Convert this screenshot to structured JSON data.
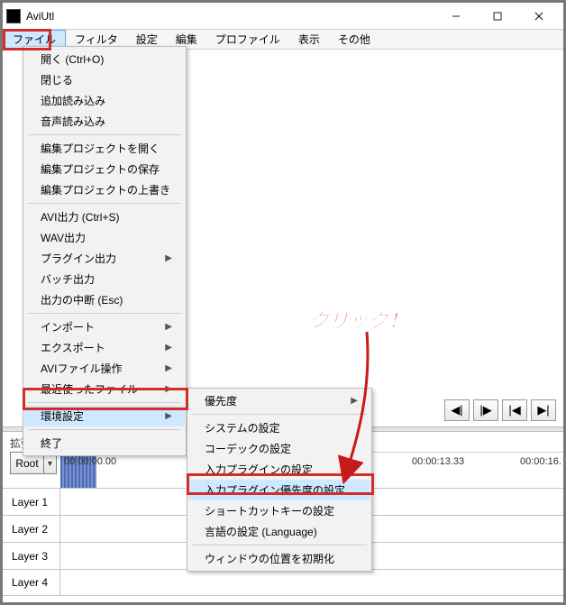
{
  "title": "AviUtl",
  "menubar": [
    "ファイル",
    "フィルタ",
    "設定",
    "編集",
    "プロファイル",
    "表示",
    "その他"
  ],
  "file_menu": {
    "open": "開く (Ctrl+O)",
    "close": "閉じる",
    "addload": "追加読み込み",
    "audload": "音声読み込み",
    "eopen": "編集プロジェクトを開く",
    "esave": "編集プロジェクトの保存",
    "eover": "編集プロジェクトの上書き",
    "aviout": "AVI出力 (Ctrl+S)",
    "wavout": "WAV出力",
    "plgout": "プラグイン出力",
    "batch": "バッチ出力",
    "abort": "出力の中断 (Esc)",
    "import": "インポート",
    "export": "エクスポート",
    "aviop": "AVIファイル操作",
    "recent": "最近使ったファイル",
    "env": "環境設定",
    "exit": "終了"
  },
  "sub_menu": {
    "prio": "優先度",
    "sys": "システムの設定",
    "codec": "コーデックの設定",
    "inplg": "入力プラグインの設定",
    "inprio": "入力プラグイン優先度の設定",
    "shortcut": "ショートカットキーの設定",
    "lang": "言語の設定 (Language)",
    "winpos": "ウィンドウの位置を初期化"
  },
  "transport": {
    "step_back": "◀|",
    "step_fwd": "|▶",
    "go_start": "|◀",
    "go_end": "▶|"
  },
  "ext_label": "拡張編集",
  "scene_btn": "Root",
  "timeline_labels": [
    "00:00:00.00",
    "00:00:13.33",
    "00:00:16."
  ],
  "layers": [
    "Layer 1",
    "Layer 2",
    "Layer 3",
    "Layer 4"
  ],
  "annotation": "クリック！"
}
